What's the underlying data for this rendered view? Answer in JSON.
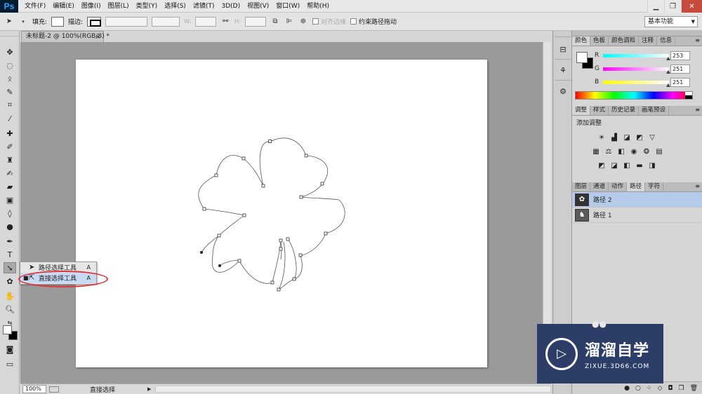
{
  "menubar": {
    "logo": "Ps",
    "items": [
      "文件(F)",
      "编辑(E)",
      "图像(I)",
      "图层(L)",
      "类型(Y)",
      "选择(S)",
      "滤镜(T)",
      "3D(D)",
      "视图(V)",
      "窗口(W)",
      "帮助(H)"
    ],
    "minimize": "▁",
    "restore": "❐",
    "close": "✕"
  },
  "options": {
    "fill_label": "填充:",
    "stroke_label": "描边:",
    "w_label": "W:",
    "h_label": "H:",
    "align_edges_label": "对齐边缘",
    "constrain_label": "约束路径拖动",
    "workspace": "基本功能"
  },
  "document": {
    "tab_title": "未标题-2 @ 100%(RGB/8) *",
    "tab_close": "×"
  },
  "flyout": {
    "items": [
      {
        "label": "路径选择工具",
        "key": "A"
      },
      {
        "label": "直接选择工具",
        "key": "A"
      }
    ]
  },
  "status": {
    "zoom": "100%",
    "text": "直接选择"
  },
  "color_panel": {
    "tabs": [
      "颜色",
      "色板",
      "颜色调和",
      "注释",
      "信息"
    ],
    "r_label": "R",
    "g_label": "G",
    "b_label": "B",
    "r": "253",
    "g": "251",
    "b": "251",
    "r_value": 253,
    "g_value": 251,
    "b_value": 251,
    "foreground": "#fdfbfb",
    "background": "#000000"
  },
  "adjust_panel": {
    "tabs": [
      "调整",
      "样式",
      "历史记录",
      "画笔预设"
    ],
    "title": "添加调整"
  },
  "paths_panel": {
    "tabs": [
      "图层",
      "通道",
      "动作",
      "路径",
      "字符"
    ],
    "paths": [
      {
        "name": "路径 2",
        "selected": true
      },
      {
        "name": "路径 1",
        "selected": false
      }
    ]
  },
  "watermark": {
    "name": "溜溜自学",
    "url": "ZIXUE.3D66.COM"
  },
  "colors": {
    "selection_ring": "#e0353b",
    "panel_selected": "#b6cbea",
    "watermark_bg": "#2c3e68"
  }
}
